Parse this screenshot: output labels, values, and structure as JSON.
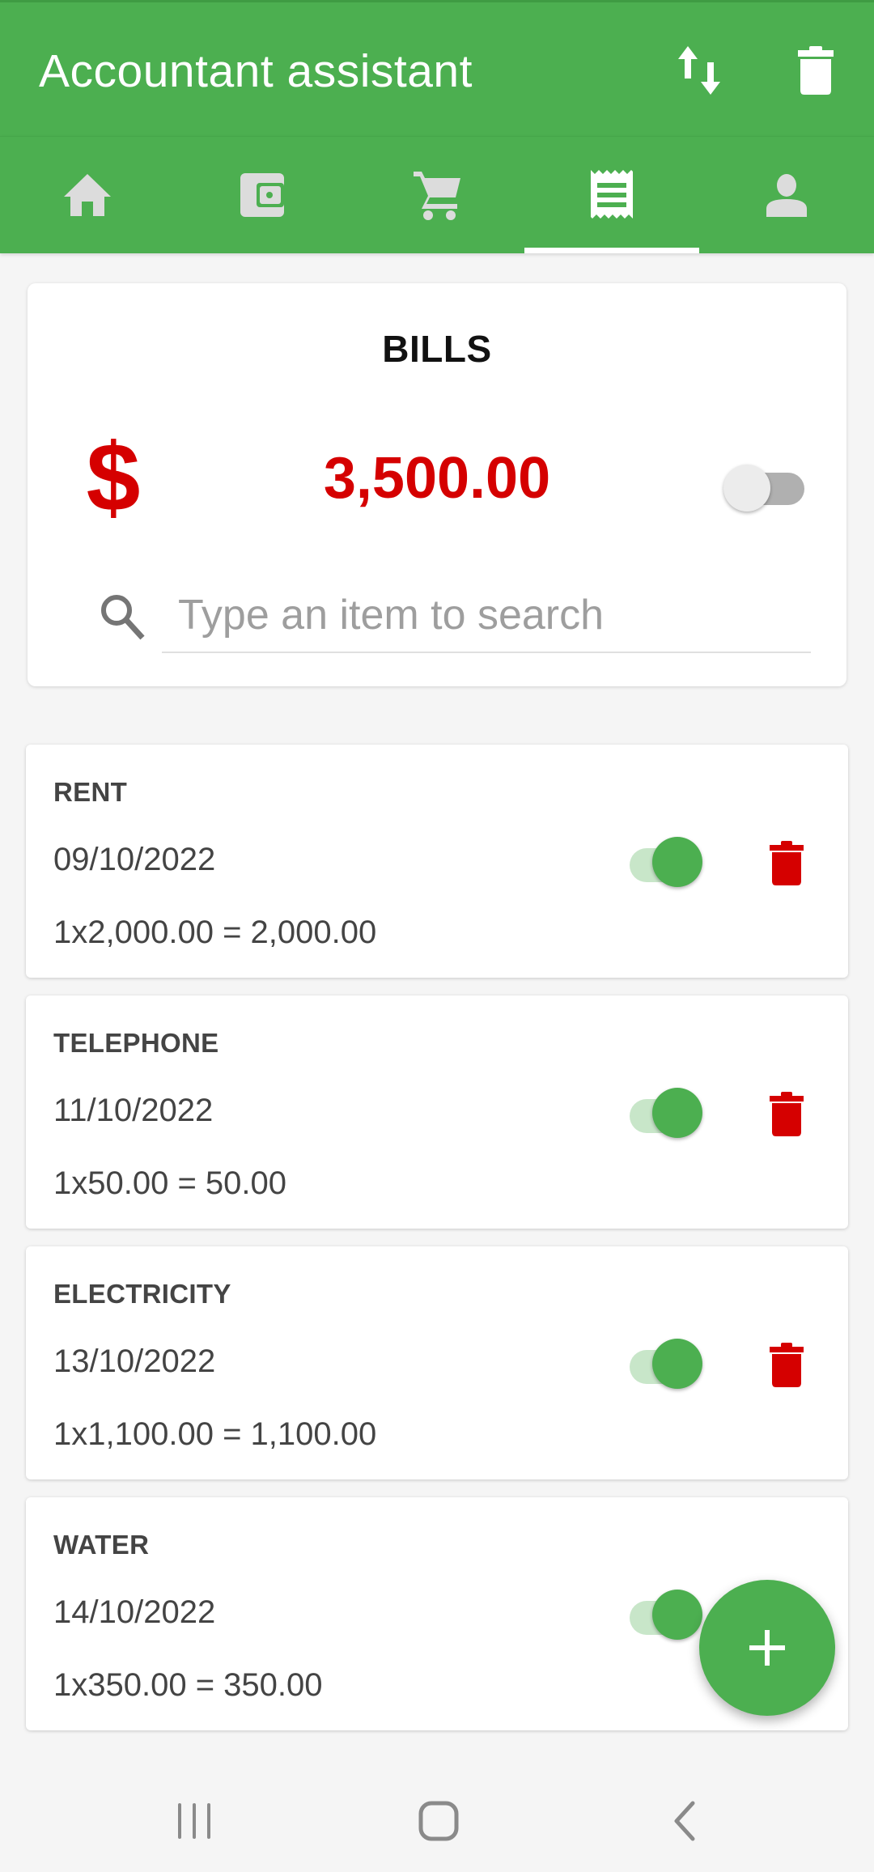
{
  "appbar": {
    "title": "Accountant assistant",
    "actions": [
      {
        "name": "sort",
        "icon": "swap-vertical-icon"
      },
      {
        "name": "delete-all",
        "icon": "trash-icon"
      }
    ],
    "color": "#4caf50"
  },
  "tabs": [
    {
      "name": "home",
      "icon": "home-icon",
      "selected": false
    },
    {
      "name": "wallet",
      "icon": "wallet-icon",
      "selected": false
    },
    {
      "name": "shopping",
      "icon": "cart-icon",
      "selected": false
    },
    {
      "name": "bills",
      "icon": "receipt-icon",
      "selected": true
    },
    {
      "name": "profile",
      "icon": "person-icon",
      "selected": false
    }
  ],
  "summary": {
    "title": "BILLS",
    "currency_symbol": "$",
    "total": "3,500.00",
    "toggle_on": false,
    "total_color": "#d50000",
    "search": {
      "value": "",
      "placeholder": "Type an item to search"
    }
  },
  "bills": [
    {
      "name": "RENT",
      "date": "09/10/2022",
      "calc": "1x2,000.00 = 2,000.00",
      "enabled": true
    },
    {
      "name": "TELEPHONE",
      "date": "11/10/2022",
      "calc": "1x50.00 = 50.00",
      "enabled": true
    },
    {
      "name": "ELECTRICITY",
      "date": "13/10/2022",
      "calc": "1x1,100.00 = 1,100.00",
      "enabled": true
    },
    {
      "name": "WATER",
      "date": "14/10/2022",
      "calc": "1x350.00 = 350.00",
      "enabled": true
    }
  ],
  "fab": {
    "icon": "plus-icon",
    "label": "+"
  },
  "system_nav": [
    {
      "name": "recents",
      "icon": "recents-icon"
    },
    {
      "name": "home",
      "icon": "home-circle-icon"
    },
    {
      "name": "back",
      "icon": "back-icon"
    }
  ]
}
